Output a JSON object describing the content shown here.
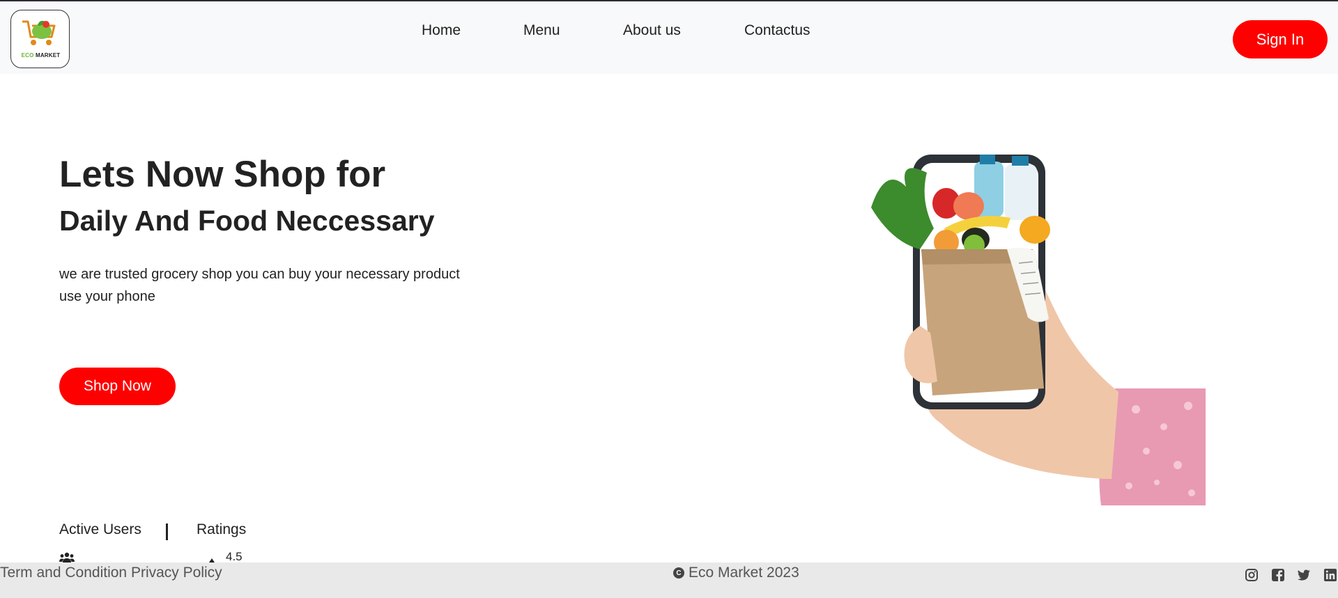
{
  "header": {
    "logo": {
      "text_eco": "ECO",
      "text_market": " MARKET",
      "icon": "shopping-cart-with-vegetables"
    },
    "nav": [
      {
        "label": "Home"
      },
      {
        "label": "Menu"
      },
      {
        "label": "About us"
      },
      {
        "label": "Contactus"
      }
    ],
    "signin_label": "Sign In"
  },
  "hero": {
    "title_line1": "Lets Now Shop for",
    "title_line2": "Daily And Food Neccessary",
    "description": "we are trusted grocery shop you can buy your necessary product use your phone",
    "cta_label": "Shop Now",
    "image": "hand-holding-phone-with-grocery-bag"
  },
  "stats": {
    "active_users_label": "Active Users",
    "ratings_label": "Ratings",
    "rating_value": "4.5",
    "users_icon": "users-icon",
    "rating_icon": "triangle-up-icon"
  },
  "footer": {
    "terms": "Term and Condition",
    "privacy": "Privacy Policy",
    "copyright_symbol": "C",
    "copyright_text": "Eco Market 2023",
    "social": [
      "instagram-icon",
      "facebook-icon",
      "twitter-icon",
      "linkedin-icon"
    ]
  },
  "colors": {
    "accent": "#ff0000",
    "navbar_bg": "#f8f9fa",
    "footer_bg": "#e9e9e9",
    "logo_green": "#6bb32e"
  }
}
